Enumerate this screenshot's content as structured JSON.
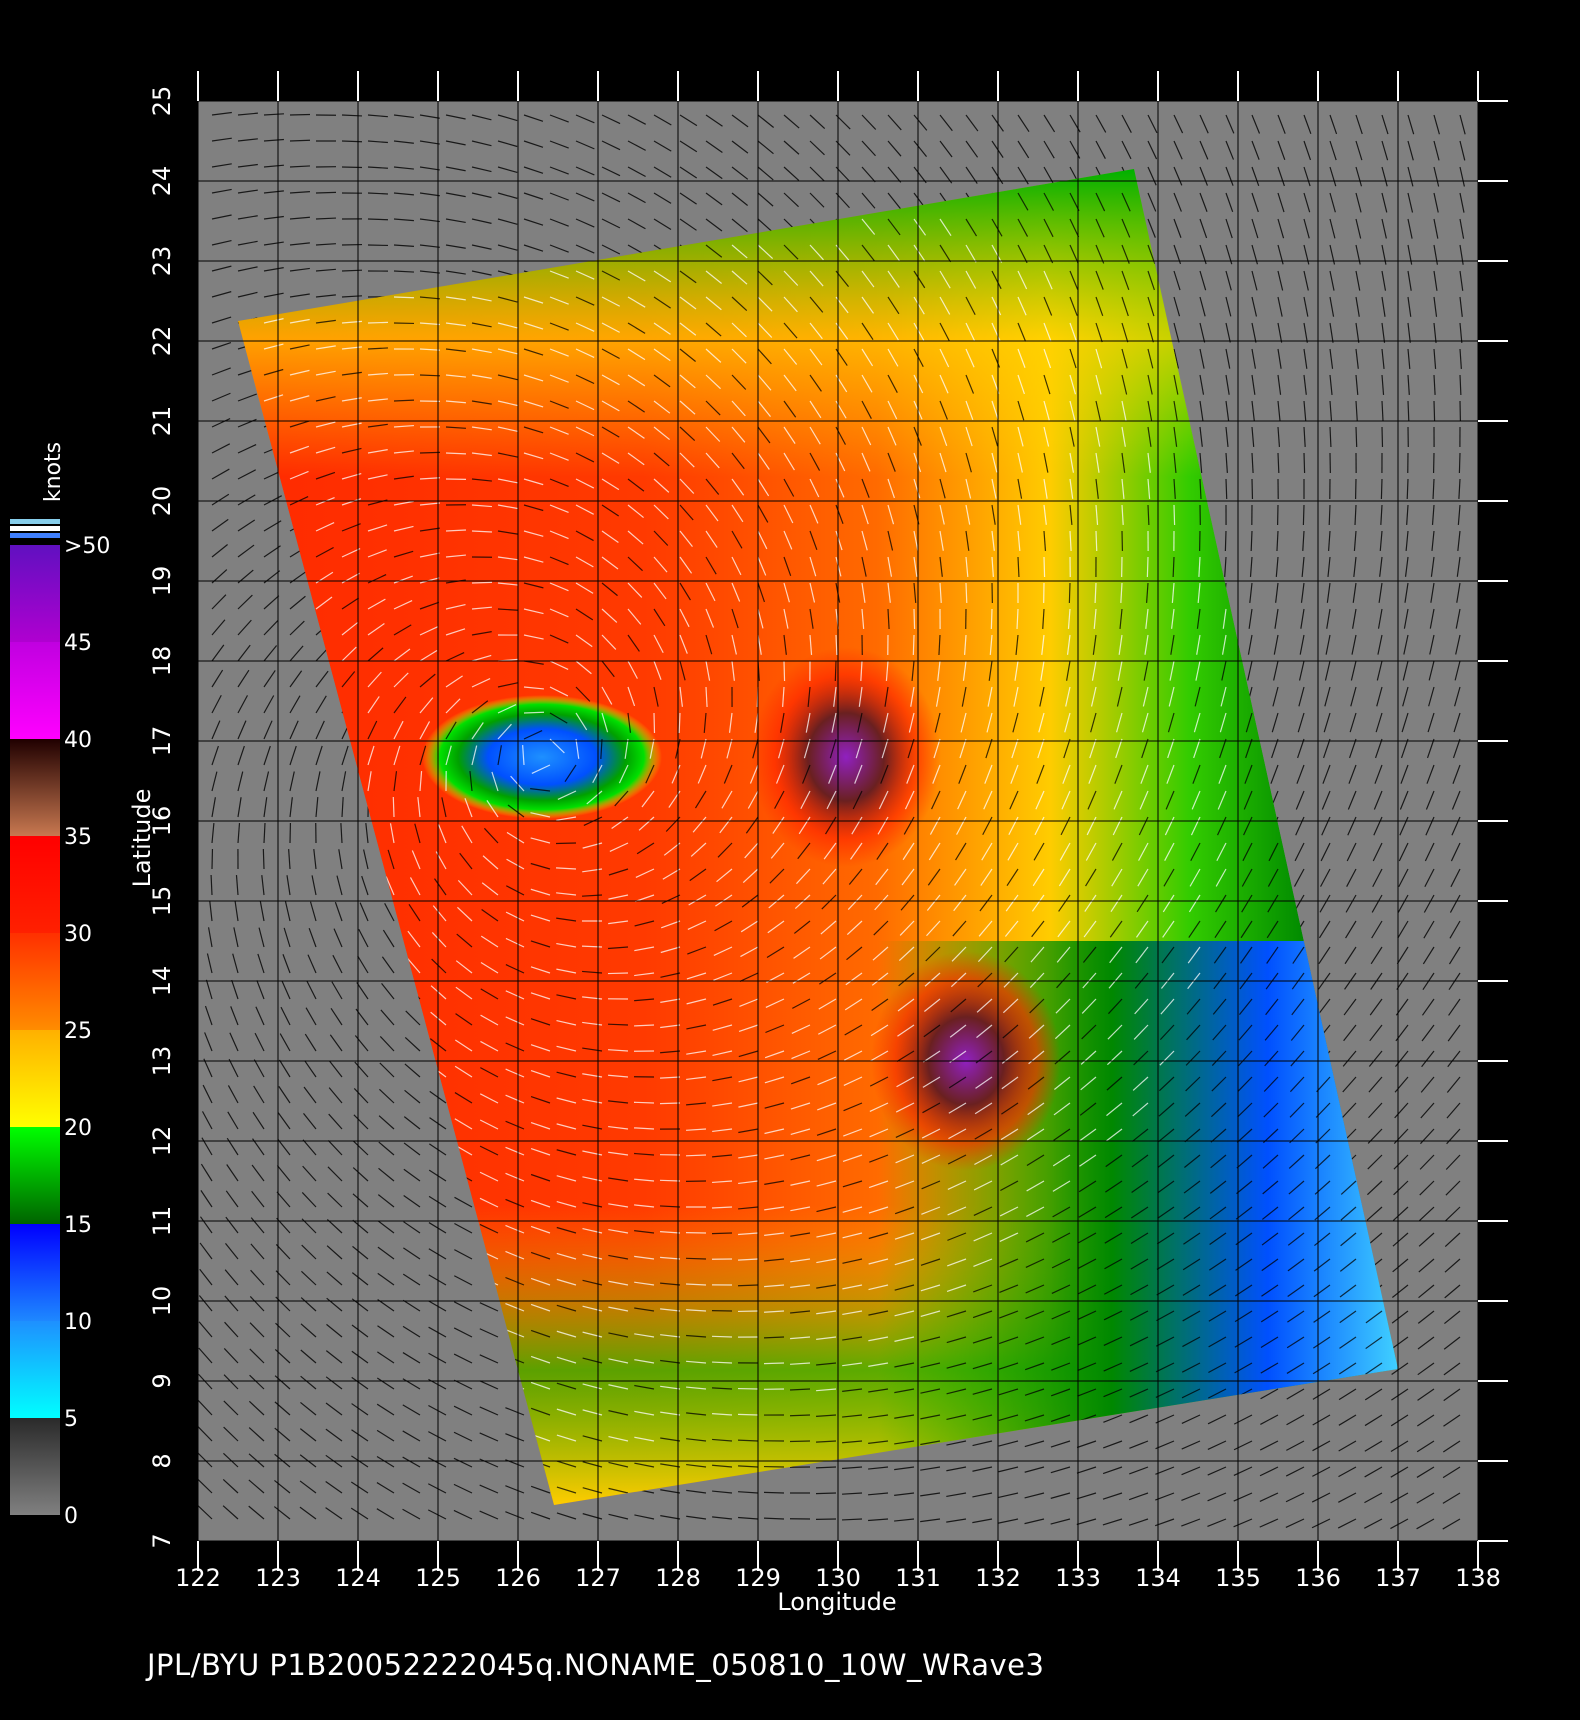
{
  "map": {
    "lon_range": [
      122,
      138
    ],
    "lat_range": [
      7,
      25
    ],
    "lon_ticks": [
      "122",
      "123",
      "124",
      "125",
      "126",
      "127",
      "128",
      "129",
      "130",
      "131",
      "132",
      "133",
      "134",
      "135",
      "136",
      "137",
      "138"
    ],
    "lat_ticks": [
      "7",
      "8",
      "9",
      "10",
      "11",
      "12",
      "13",
      "14",
      "15",
      "16",
      "17",
      "18",
      "19",
      "20",
      "21",
      "22",
      "23",
      "24",
      "25"
    ],
    "xlabel": "Longitude",
    "ylabel": "Latitude",
    "background_color": "#808080",
    "grid_color": "#000000",
    "swath_corners_lonlat": [
      [
        122.5,
        22.25
      ],
      [
        133.7,
        24.15
      ],
      [
        137.0,
        9.15
      ],
      [
        126.45,
        7.45
      ]
    ],
    "storm_centers": [
      {
        "kind": "calm-eye",
        "lon": 126.3,
        "lat": 16.8
      },
      {
        "kind": "high-wind-core",
        "lon": 130.1,
        "lat": 16.8
      },
      {
        "kind": "high-wind-core",
        "lon": 131.6,
        "lat": 13.0
      }
    ]
  },
  "legend": {
    "title": "knots",
    "labels": [
      ">50",
      "45",
      "40",
      "35",
      "30",
      "25",
      "20",
      "15",
      "10",
      "5",
      "0"
    ],
    "bands": [
      {
        "from": 0,
        "to": 5,
        "colors": [
          "#808080",
          "#2a2a2a"
        ]
      },
      {
        "from": 5,
        "to": 10,
        "colors": [
          "#00ffff",
          "#1e90ff"
        ]
      },
      {
        "from": 10,
        "to": 15,
        "colors": [
          "#1e88ff",
          "#0000ff"
        ]
      },
      {
        "from": 15,
        "to": 20,
        "colors": [
          "#006400",
          "#00ff00"
        ]
      },
      {
        "from": 20,
        "to": 25,
        "colors": [
          "#ffff00",
          "#ffb000"
        ]
      },
      {
        "from": 25,
        "to": 30,
        "colors": [
          "#ff8c00",
          "#ff3000"
        ]
      },
      {
        "from": 30,
        "to": 35,
        "colors": [
          "#ff2000",
          "#ff0000"
        ]
      },
      {
        "from": 35,
        "to": 40,
        "colors": [
          "#c87850",
          "#200000"
        ]
      },
      {
        "from": 40,
        "to": 45,
        "colors": [
          "#ff00ff",
          "#c000e0"
        ]
      },
      {
        "from": 45,
        "to": 50,
        "colors": [
          "#b000d0",
          "#6010c0"
        ]
      }
    ],
    "overflow_colors": [
      "#87ceeb",
      "#ffffff",
      "#4080ff"
    ]
  },
  "footer": {
    "text": "JPL/BYU  P1B20052222045q.NONAME_050810_10W_WRave3"
  }
}
